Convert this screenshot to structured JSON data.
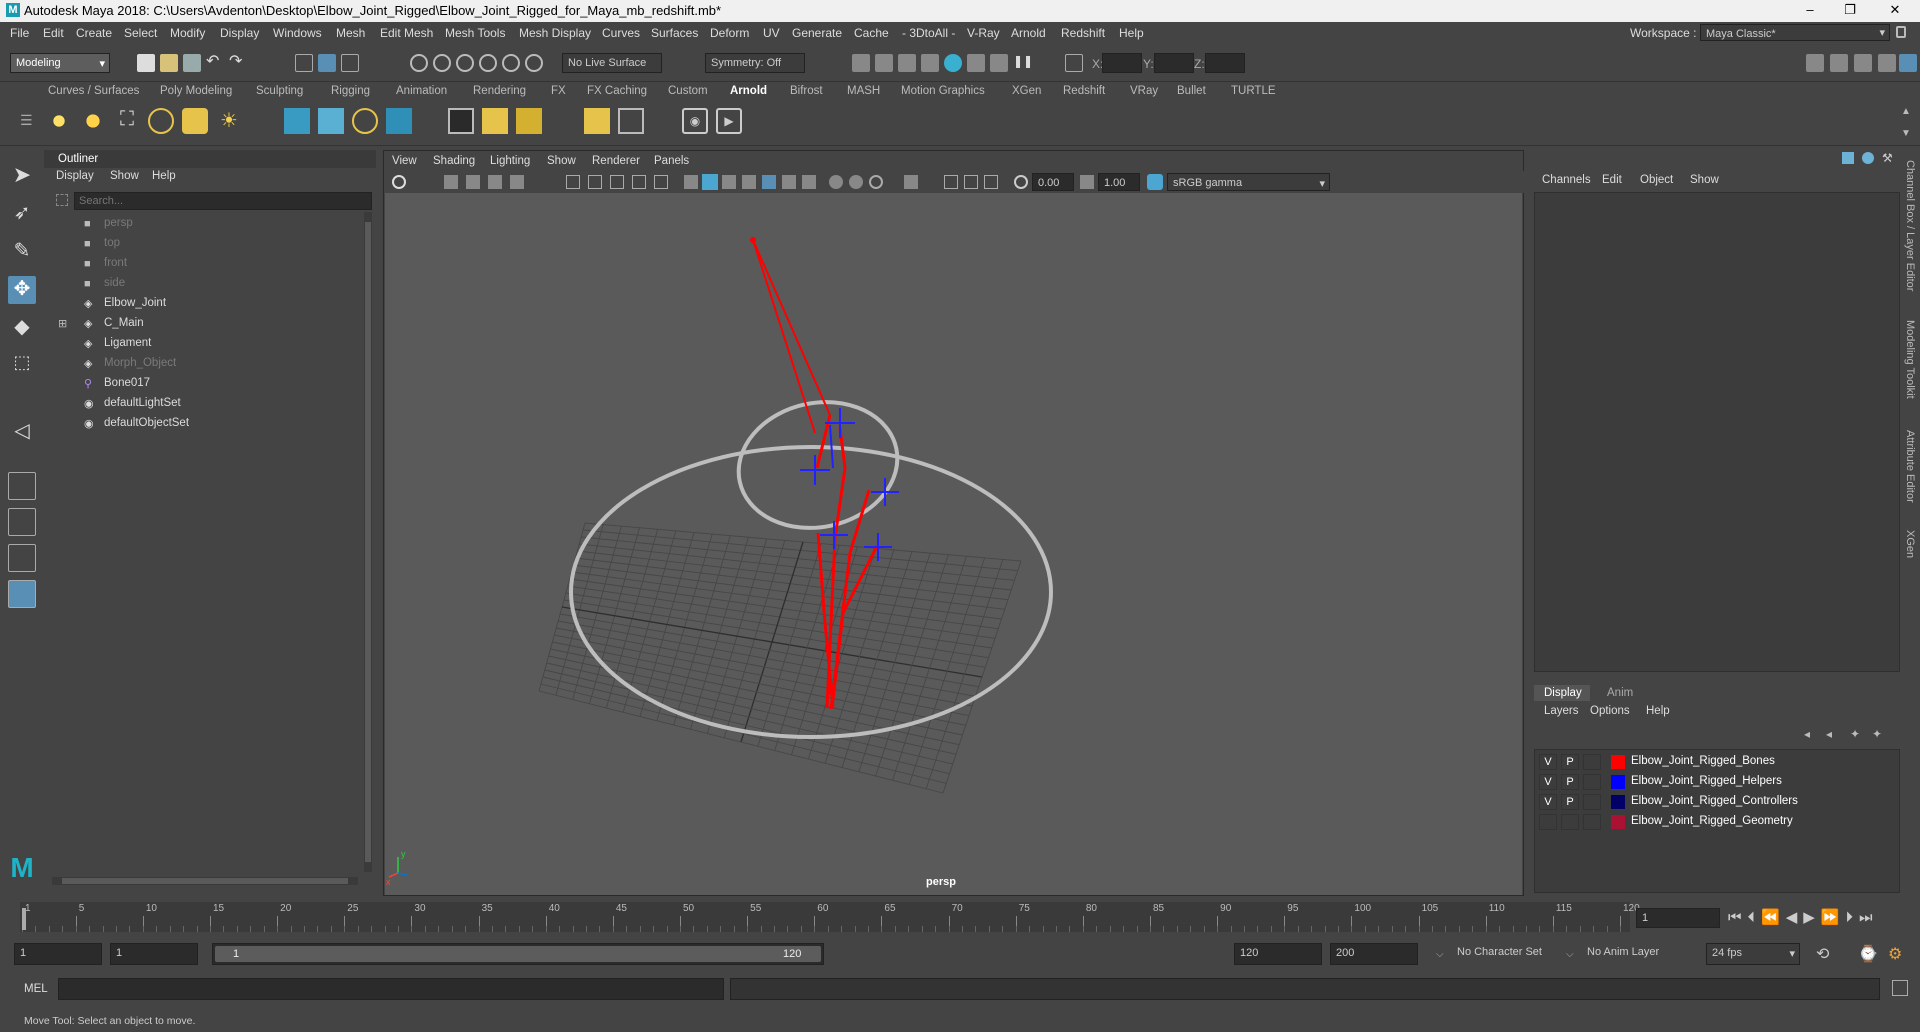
{
  "window": {
    "app_letter": "M",
    "title": "Autodesk Maya 2018: C:\\Users\\Avdenton\\Desktop\\Elbow_Joint_Rigged\\Elbow_Joint_Rigged_for_Maya_mb_redshift.mb*",
    "minimize": "–",
    "maximize": "❐",
    "close": "✕"
  },
  "menus": [
    "File",
    "Edit",
    "Create",
    "Select",
    "Modify",
    "Display",
    "Windows",
    "Mesh",
    "Edit Mesh",
    "Mesh Tools",
    "Mesh Display",
    "Curves",
    "Surfaces",
    "Deform",
    "UV",
    "Generate",
    "Cache",
    "- 3DtoAll -",
    "V-Ray",
    "Arnold",
    "Redshift",
    "Help"
  ],
  "workspace": {
    "label": "Workspace :",
    "value": "Maya Classic*"
  },
  "status": {
    "mode": "Modeling",
    "live_surface": "No Live Surface",
    "symmetry": "Symmetry: Off",
    "x_label": "X:",
    "y_label": "Y:",
    "z_label": "Z:"
  },
  "shelf_tabs": [
    "Curves / Surfaces",
    "Poly Modeling",
    "Sculpting",
    "Rigging",
    "Animation",
    "Rendering",
    "FX",
    "FX Caching",
    "Custom",
    "Arnold",
    "Bifrost",
    "MASH",
    "Motion Graphics",
    "XGen",
    "Redshift",
    "VRay",
    "Bullet",
    "TURTLE"
  ],
  "shelf_active": "Arnold",
  "outliner": {
    "title": "Outliner",
    "menu": [
      "Display",
      "Show",
      "Help"
    ],
    "search_placeholder": "Search...",
    "items": [
      {
        "label": "persp",
        "type": "camera",
        "dim": true
      },
      {
        "label": "top",
        "type": "camera",
        "dim": true
      },
      {
        "label": "front",
        "type": "camera",
        "dim": true
      },
      {
        "label": "side",
        "type": "camera",
        "dim": true
      },
      {
        "label": "Elbow_Joint",
        "type": "transform",
        "dim": false
      },
      {
        "label": "C_Main",
        "type": "transform",
        "dim": false,
        "expandable": true
      },
      {
        "label": "Ligament",
        "type": "transform",
        "dim": false
      },
      {
        "label": "Morph_Object",
        "type": "transform",
        "dim": true
      },
      {
        "label": "Bone017",
        "type": "joint",
        "dim": false
      },
      {
        "label": "defaultLightSet",
        "type": "set",
        "dim": false
      },
      {
        "label": "defaultObjectSet",
        "type": "set",
        "dim": false
      }
    ]
  },
  "viewport": {
    "menu": [
      "View",
      "Shading",
      "Lighting",
      "Show",
      "Renderer",
      "Panels"
    ],
    "exposure": "0.00",
    "gamma": "1.00",
    "color_space": "sRGB gamma",
    "camera_label": "persp",
    "axis_y": "y",
    "axis_x": "x"
  },
  "channel_box": {
    "menu": [
      "Channels",
      "Edit",
      "Object",
      "Show"
    ]
  },
  "layer_editor": {
    "tabs": [
      "Display",
      "Anim"
    ],
    "menu": [
      "Layers",
      "Options",
      "Help"
    ],
    "layers": [
      {
        "v": "V",
        "p": "P",
        "color": "#ff0000",
        "name": "Elbow_Joint_Rigged_Bones"
      },
      {
        "v": "V",
        "p": "P",
        "color": "#0000ff",
        "name": "Elbow_Joint_Rigged_Helpers"
      },
      {
        "v": "V",
        "p": "P",
        "color": "#000066",
        "name": "Elbow_Joint_Rigged_Controllers"
      },
      {
        "v": "",
        "p": "",
        "color": "#aa1133",
        "name": "Elbow_Joint_Rigged_Geometry"
      }
    ]
  },
  "side_tabs": [
    "Channel Box / Layer Editor",
    "Modeling Toolkit",
    "Attribute Editor",
    "XGen"
  ],
  "timeline": {
    "ticks": [
      "1",
      "5",
      "10",
      "15",
      "20",
      "25",
      "30",
      "35",
      "40",
      "45",
      "50",
      "55",
      "60",
      "65",
      "70",
      "75",
      "80",
      "85",
      "90",
      "95",
      "100",
      "105",
      "110",
      "115",
      "120"
    ],
    "current_frame": "1"
  },
  "range": {
    "start": "1",
    "start2": "1",
    "slider_start": "1",
    "slider_end": "120",
    "end": "120",
    "end2": "200",
    "character_set": "No Character Set",
    "anim_layer": "No Anim Layer",
    "fps": "24 fps"
  },
  "command": {
    "lang": "MEL"
  },
  "help_line": "Move Tool: Select an object to move."
}
